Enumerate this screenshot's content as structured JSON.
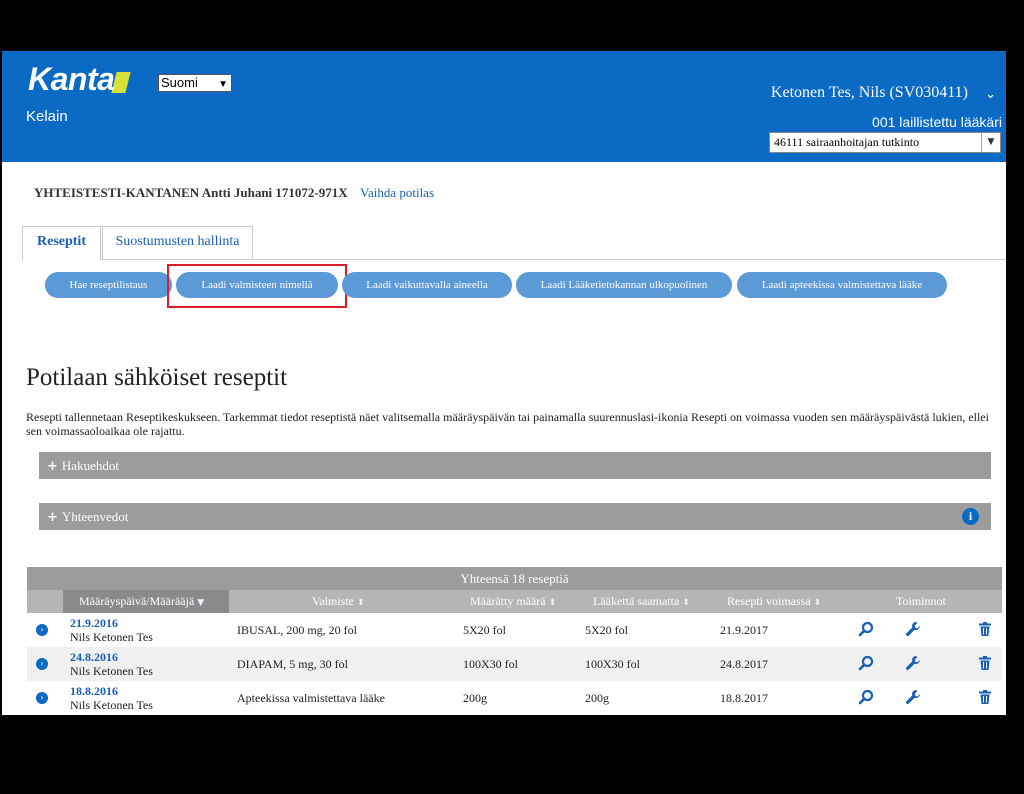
{
  "header": {
    "logo": "Kanta",
    "app_name": "Kelain",
    "language": "Suomi",
    "user_name": "Ketonen Tes, Nils (SV030411)",
    "user_role": "001 laillistettu lääkäri",
    "degree": "46111 sairaanhoitajan tutkinto"
  },
  "patient": {
    "name": "YHTEISTESTI-KANTANEN Antti Juhani 171072-971X",
    "change_link": "Vaihda potilas"
  },
  "tabs": [
    {
      "label": "Reseptit",
      "active": true
    },
    {
      "label": "Suostumusten hallinta",
      "active": false
    }
  ],
  "actions": [
    "Hae reseptilistaus",
    "Laadi valmisteen nimellä",
    "Laadi vaikuttavalla aineella",
    "Laadi Lääketietokannan ulkopuolinen",
    "Laadi apteekissa valmistettava lääke"
  ],
  "main": {
    "title": "Potilaan sähköiset reseptit",
    "description": "Resepti tallennetaan Reseptikeskukseen. Tarkemmat tiedot reseptistä näet valitsemalla määräyspäivän tai painamalla suurennuslasi-ikonia Resepti on voimassa vuoden sen määräyspäivästä lukien, ellei sen voimassaoloaikaa ole rajattu.",
    "panels": [
      "Hakuehdot",
      "Yhteenvedot"
    ]
  },
  "table": {
    "caption": "Yhteensä 18 reseptiä",
    "columns": [
      "Määräyspäivä/Määrääjä",
      "Valmiste",
      "Määrätty määrä",
      "Lääkettä saamatta",
      "Resepti voimassa",
      "Toiminnot"
    ],
    "rows": [
      {
        "date": "21.9.2016",
        "prescriber": "Nils Ketonen Tes",
        "product": "IBUSAL, 200 mg, 20 fol",
        "amount": "5X20 fol",
        "remaining": "5X20 fol",
        "valid": "21.9.2017"
      },
      {
        "date": "24.8.2016",
        "prescriber": "Nils Ketonen Tes",
        "product": "DIAPAM, 5 mg, 30 fol",
        "amount": "100X30 fol",
        "remaining": "100X30 fol",
        "valid": "24.8.2017"
      },
      {
        "date": "18.8.2016",
        "prescriber": "Nils Ketonen Tes",
        "product": "Apteekissa valmistettava lääke",
        "amount": "200g",
        "remaining": "200g",
        "valid": "18.8.2017"
      }
    ]
  },
  "colors": {
    "header_bg": "#0a6ac4",
    "button_bg": "#5b9ad6",
    "highlight": "#d9202a",
    "panel_bg": "#9c9c9c"
  }
}
